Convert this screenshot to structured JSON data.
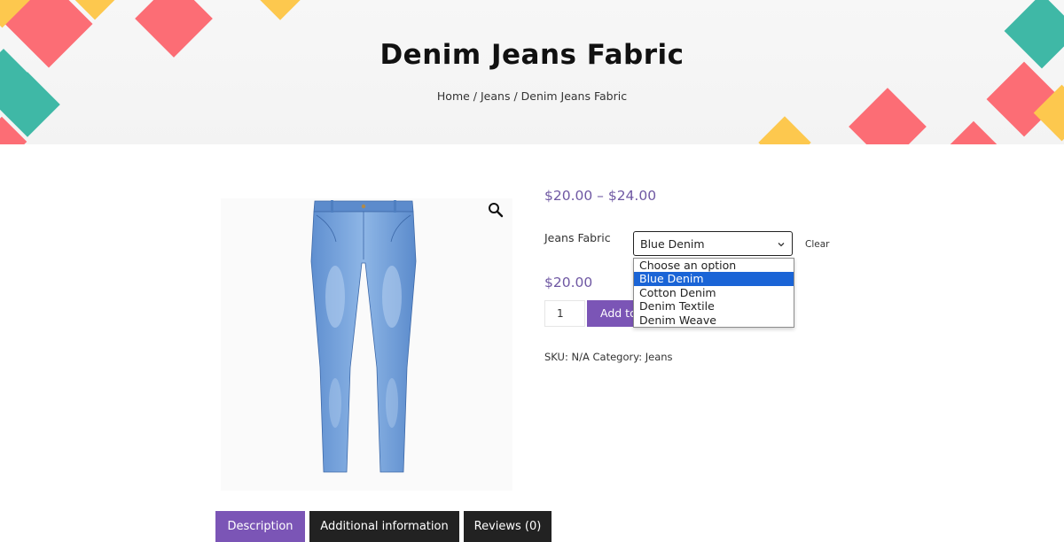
{
  "hero": {
    "title": "Denim Jeans Fabric",
    "breadcrumb": {
      "home": "Home",
      "sep": " / ",
      "category": "Jeans",
      "current": "Denim Jeans Fabric"
    }
  },
  "product": {
    "image_alt_icon": "jeans-product-image",
    "zoom_icon": "magnifier-icon",
    "price_range": "$20.00 – $24.00",
    "variation": {
      "label": "Jeans Fabric",
      "selected": "Blue Denim",
      "clear_label": "Clear",
      "options": [
        "Choose an option",
        "Blue Denim",
        "Cotton Denim",
        "Denim Textile",
        "Denim Weave"
      ],
      "highlighted_index": 1
    },
    "price": "$20.00",
    "quantity": "1",
    "add_to_cart_label": "Add to cart",
    "meta": {
      "sku_label": "SKU:",
      "sku_value": "N/A",
      "category_label": "Category:",
      "category_value": "Jeans"
    }
  },
  "tabs": [
    {
      "label": "Description",
      "active": true
    },
    {
      "label": "Additional information",
      "active": false
    },
    {
      "label": "Reviews (0)",
      "active": false
    }
  ],
  "colors": {
    "accent": "#7b55b6",
    "price": "#6f58a3",
    "tab_dark": "#222222",
    "highlight": "#1a64d6",
    "tile_pink": "#fc6d75",
    "tile_teal": "#3fb8a6",
    "tile_yellow": "#fdc84e"
  }
}
